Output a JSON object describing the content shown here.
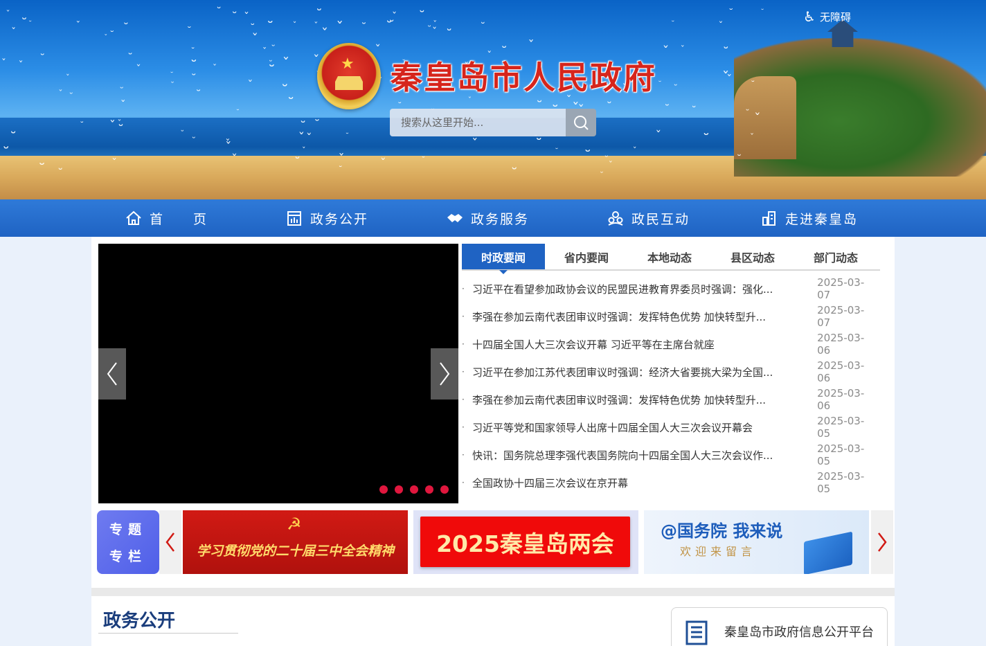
{
  "header": {
    "site_title": "秦皇岛市人民政府",
    "accessibility_label": "无障碍",
    "search_placeholder": "搜索从这里开始..."
  },
  "nav": {
    "items": [
      {
        "label": "首　　页",
        "icon": "home-icon"
      },
      {
        "label": "政务公开",
        "icon": "building-chart-icon"
      },
      {
        "label": "政务服务",
        "icon": "handshake-icon"
      },
      {
        "label": "政民互动",
        "icon": "people-icon"
      },
      {
        "label": "走进秦皇岛",
        "icon": "city-icon"
      }
    ]
  },
  "slider": {
    "dots": 5
  },
  "news": {
    "tabs": [
      "时政要闻",
      "省内要闻",
      "本地动态",
      "县区动态",
      "部门动态"
    ],
    "active_tab": "时政要闻",
    "items": [
      {
        "title": "习近平在看望参加政协会议的民盟民进教育界委员时强调：强化...",
        "date": "2025-03-07"
      },
      {
        "title": "李强在参加云南代表团审议时强调：发挥特色优势 加快转型升...",
        "date": "2025-03-07"
      },
      {
        "title": "十四届全国人大三次会议开幕 习近平等在主席台就座",
        "date": "2025-03-06"
      },
      {
        "title": "习近平在参加江苏代表团审议时强调：经济大省要挑大梁为全国...",
        "date": "2025-03-06"
      },
      {
        "title": "李强在参加云南代表团审议时强调：发挥特色优势 加快转型升...",
        "date": "2025-03-06"
      },
      {
        "title": "习近平等党和国家领导人出席十四届全国人大三次会议开幕会",
        "date": "2025-03-05"
      },
      {
        "title": "快讯：国务院总理李强代表国务院向十四届全国人大三次会议作...",
        "date": "2025-03-05"
      },
      {
        "title": "全国政协十四届三次会议在京开幕",
        "date": "2025-03-05"
      }
    ]
  },
  "special": {
    "badge_line1": "专题",
    "badge_line2": "专栏",
    "cards": [
      {
        "text": "学习贯彻党的二十届三中全会精神"
      },
      {
        "text": "2025秦皇岛两会"
      },
      {
        "text1": "@国务院 我来说",
        "text2": "欢迎来留言"
      }
    ]
  },
  "section": {
    "title": "政务公开",
    "platform_label": "秦皇岛市政府信息公开平台"
  },
  "colors": {
    "nav_blue": "#1f63c3",
    "title_red": "#d6251c",
    "dot_red": "#e0173e"
  }
}
